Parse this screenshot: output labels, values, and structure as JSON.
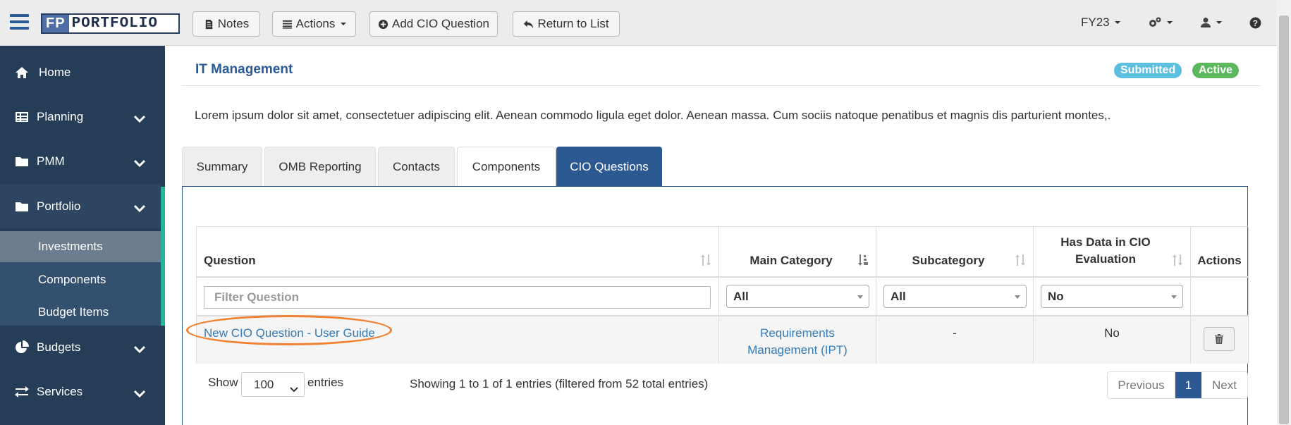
{
  "navbar": {
    "logo_fp": "FP",
    "logo_text": "PORTFOLIO",
    "buttons": [
      {
        "label": "Notes",
        "icon": "notes-icon"
      },
      {
        "label": "Actions",
        "icon": "list-icon"
      },
      {
        "label": "Add CIO Question",
        "icon": "plus-circle-icon"
      },
      {
        "label": "Return to List",
        "icon": "reply-icon"
      }
    ],
    "fiscal_year": "FY23"
  },
  "sidebar": {
    "items": [
      {
        "label": "Home",
        "icon": "home-icon"
      },
      {
        "label": "Planning",
        "icon": "table-icon"
      },
      {
        "label": "PMM",
        "icon": "folder-icon"
      },
      {
        "label": "Portfolio",
        "icon": "folder-icon"
      },
      {
        "label": "Budgets",
        "icon": "pie-chart-icon"
      },
      {
        "label": "Services",
        "icon": "exchange-icon"
      }
    ],
    "subitems": [
      "Investments",
      "Components",
      "Budget Items"
    ]
  },
  "page": {
    "title": "IT Management",
    "badges": {
      "submitted": "Submitted",
      "active": "Active"
    },
    "description": "Lorem ipsum dolor sit amet, consectetuer adipiscing elit. Aenean commodo ligula eget dolor. Aenean massa. Cum sociis natoque penatibus et magnis dis parturient montes,."
  },
  "tabs": [
    "Summary",
    "OMB Reporting",
    "Contacts",
    "Components",
    "CIO Questions"
  ],
  "table": {
    "headers": {
      "question": "Question",
      "main_category": "Main Category",
      "subcategory": "Subcategory",
      "has_data_line1": "Has Data in CIO",
      "has_data_line2": "Evaluation",
      "actions": "Actions"
    },
    "filters": {
      "question_placeholder": "Filter Question",
      "main_category": "All",
      "subcategory": "All",
      "has_data": "No"
    },
    "rows": [
      {
        "question": "New CIO Question - User Guide",
        "main_category_line1": "Requirements",
        "main_category_line2": "Management (IPT)",
        "subcategory": "-",
        "has_data": "No"
      }
    ]
  },
  "footer": {
    "show": "Show",
    "page_length": "100",
    "entries": "entries",
    "info": "Showing 1 to 1 of 1 entries (filtered from 52 total entries)",
    "previous": "Previous",
    "current_page": "1",
    "next": "Next"
  },
  "colors": {
    "primary": "#2d5992",
    "sidebar": "#263d57",
    "accent": "#28b49a",
    "submitted": "#5bc0de",
    "active": "#5cb85c",
    "highlight_oval": "#f08232"
  }
}
